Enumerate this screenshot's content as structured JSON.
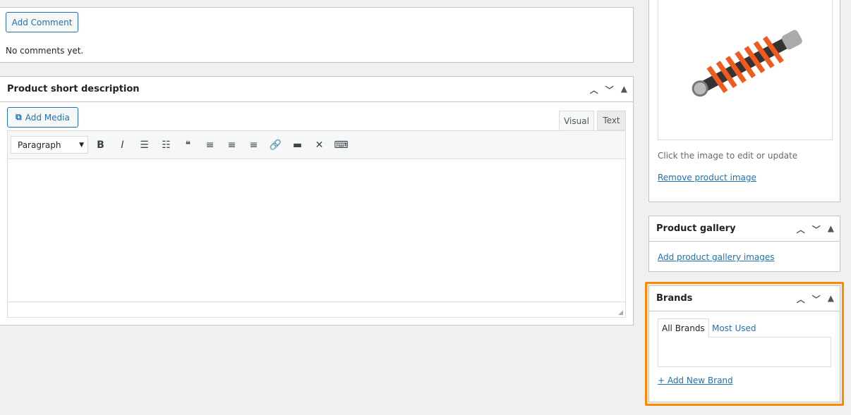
{
  "comments": {
    "add_button": "Add Comment",
    "empty": "No comments yet."
  },
  "short_desc": {
    "title": "Product short description",
    "add_media": "Add Media",
    "tabs": [
      "Visual",
      "Text"
    ],
    "format": "Paragraph",
    "toolbar": [
      {
        "icon": "bold-icon",
        "g": "B"
      },
      {
        "icon": "italic-icon",
        "g": "I"
      },
      {
        "icon": "bullet-list-icon",
        "g": "☰"
      },
      {
        "icon": "numbered-list-icon",
        "g": "☷"
      },
      {
        "icon": "blockquote-icon",
        "g": "❝"
      },
      {
        "icon": "align-left-icon",
        "g": "≡"
      },
      {
        "icon": "align-center-icon",
        "g": "≡"
      },
      {
        "icon": "align-right-icon",
        "g": "≡"
      },
      {
        "icon": "link-icon",
        "g": "🔗"
      },
      {
        "icon": "read-more-icon",
        "g": "▬"
      },
      {
        "icon": "fullscreen-icon",
        "g": "✕"
      },
      {
        "icon": "keyboard-icon",
        "g": "⌨"
      }
    ]
  },
  "product_image": {
    "hint": "Click the image to edit or update",
    "remove": "Remove product image"
  },
  "gallery": {
    "title": "Product gallery",
    "add": "Add product gallery images"
  },
  "brands": {
    "title": "Brands",
    "tabs": [
      "All Brands",
      "Most Used"
    ],
    "add": "+ Add New Brand",
    "highlight_color": "#ff8a00"
  },
  "colors": {
    "accent": "#2271b1"
  }
}
